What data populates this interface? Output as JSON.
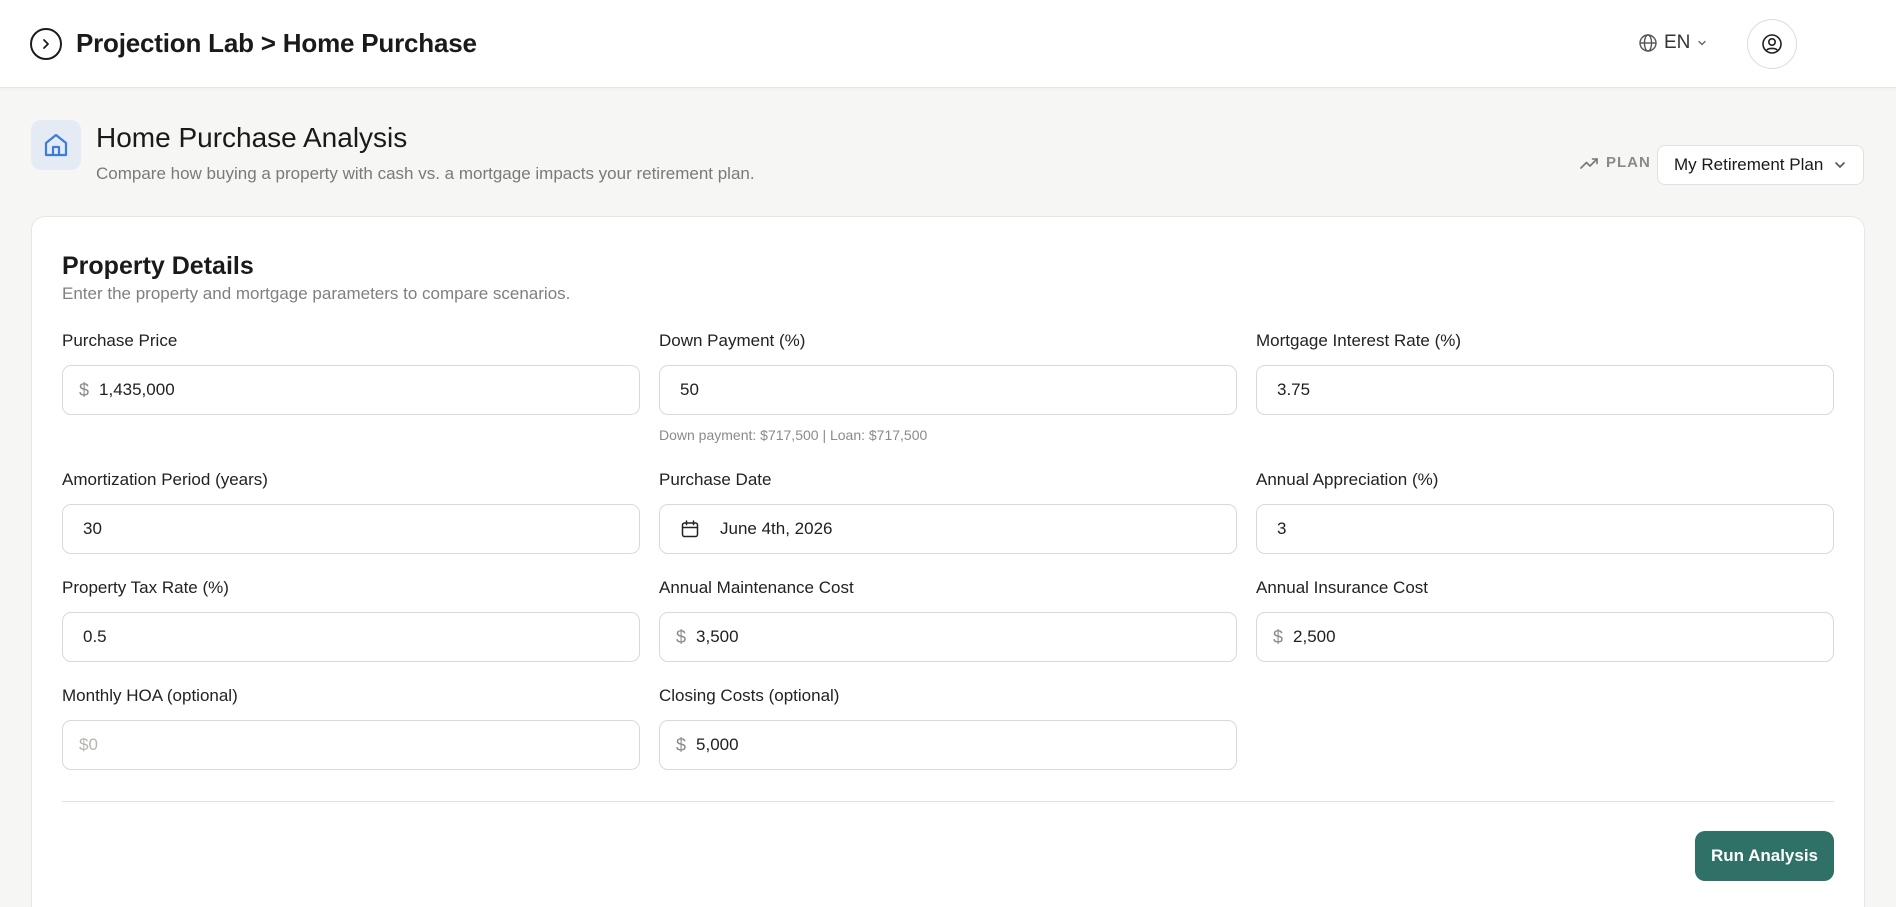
{
  "topbar": {
    "breadcrumb": "Projection Lab > Home Purchase",
    "language": "EN"
  },
  "header": {
    "title": "Home Purchase Analysis",
    "subtitle": "Compare how buying a property with cash vs. a mortgage impacts your retirement plan.",
    "plan_label": "PLAN",
    "plan_selected": "My Retirement Plan"
  },
  "card": {
    "title": "Property Details",
    "description": "Enter the property and mortgage parameters to compare scenarios.",
    "fields": {
      "purchase_price": {
        "label": "Purchase Price",
        "prefix": "$",
        "value": "1,435,000"
      },
      "down_payment": {
        "label": "Down Payment (%)",
        "value": "50",
        "helper": "Down payment: $717,500 | Loan: $717,500"
      },
      "interest_rate": {
        "label": "Mortgage Interest Rate (%)",
        "value": "3.75"
      },
      "amortization": {
        "label": "Amortization Period (years)",
        "value": "30"
      },
      "purchase_date": {
        "label": "Purchase Date",
        "value": "June 4th, 2026"
      },
      "appreciation": {
        "label": "Annual Appreciation (%)",
        "value": "3"
      },
      "property_tax": {
        "label": "Property Tax Rate (%)",
        "value": "0.5"
      },
      "maintenance": {
        "label": "Annual Maintenance Cost",
        "prefix": "$",
        "value": "3,500"
      },
      "insurance": {
        "label": "Annual Insurance Cost",
        "prefix": "$",
        "value": "2,500"
      },
      "hoa": {
        "label": "Monthly HOA (optional)",
        "placeholder": "$0"
      },
      "closing_costs": {
        "label": "Closing Costs (optional)",
        "prefix": "$",
        "value": "5,000"
      }
    },
    "run_button": "Run Analysis"
  },
  "colors": {
    "accent": "#2f7166",
    "icon_blue": "#3b7dd8",
    "icon_bg": "#e4ebf5"
  }
}
